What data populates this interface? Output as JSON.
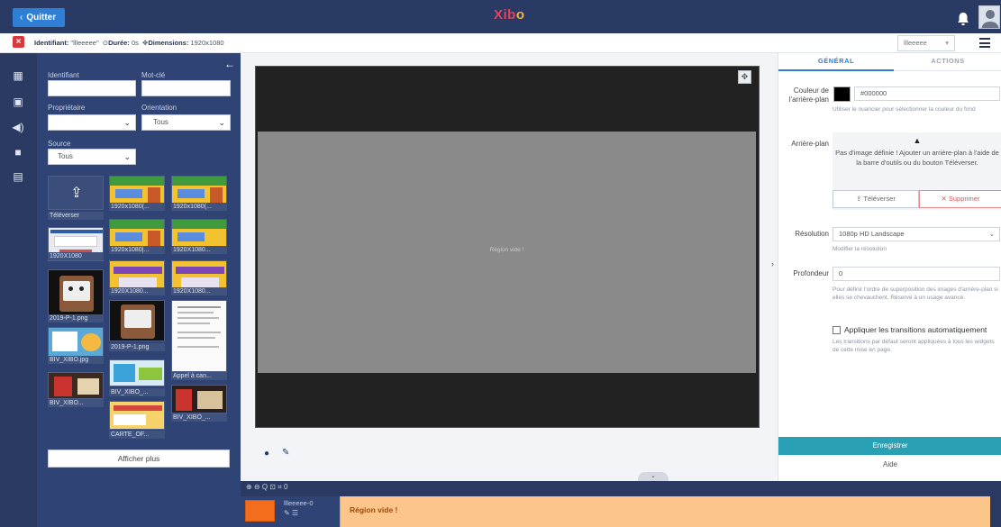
{
  "topbar": {
    "quit_label": "Quitter",
    "logo_a": "Xib",
    "logo_b": "o"
  },
  "infobar": {
    "id_label": "Identifiant:",
    "id_value": "\"llleeeee\"",
    "duration_label": "Durée:",
    "duration_value": "0s",
    "dimensions_label": "Dimensions:",
    "dimensions_value": "1920x1080",
    "layout_selected": "llleeeee"
  },
  "toolbox": {
    "identifier_label": "Identifiant",
    "keyword_label": "Mot-clé",
    "owner_label": "Propriétaire",
    "orientation_label": "Orientation",
    "orientation_value": "Tous",
    "source_label": "Source",
    "source_value": "Tous",
    "upload_label": "Téléverser",
    "show_more": "Afficher plus",
    "col1_labels": [
      "1920X1080",
      "2019-P-1.png",
      "BIV_XIBO.jpg",
      "BIV_XIBO..."
    ],
    "col2_labels": [
      "1920x1080(...",
      "1920x1080|...",
      "1920X1080...",
      "2019-P-1.png",
      "BIV_XIBO_...",
      "CARTE_OF..."
    ],
    "col3_labels": [
      "1920x1080(...",
      "1920X1080...",
      "1920X1080...",
      "Appel à can...",
      "BIV_XIBO_..."
    ]
  },
  "viewer": {
    "region_text": "Région vide !"
  },
  "timeline": {
    "tools": "⊕  ⊖  Q  ⊡        ⌗ 0",
    "region_name": "llleeeee-0",
    "track_text": "Région vide !"
  },
  "props": {
    "tab_general": "GÉNÉRAL",
    "tab_actions": "ACTIONS",
    "bgcolor_label": "Couleur de l'arrière-plan",
    "bgcolor_value": "#000000",
    "bgcolor_help": "Utiliser le nuancier pour sélectionner la couleur du fond",
    "bgimage_label": "Arrière-plan",
    "bgimage_warn": "Pas d'image définie ! Ajouter un arrière-plan à l'aide de la barre d'outils ou du bouton Téléverser.",
    "upload_btn": "Téléverser",
    "delete_btn": "Supprimer",
    "resolution_label": "Résolution",
    "resolution_value": "1080p HD Landscape",
    "resolution_help": "Modifier la résolution",
    "depth_label": "Profondeur",
    "depth_value": "0",
    "depth_help": "Pour définir l'ordre de superposition des images d'arrière-plan si elles se chevauchent. Réservé à un usage avancé.",
    "autotrans_label": "Appliquer les transitions automatiquement",
    "autotrans_help": "Les transitions par défaut seront appliquées à tous les widgets de cette mise en page.",
    "save_btn": "Enregistrer",
    "help_btn": "Aide"
  },
  "colors": {
    "accent": "#2f7fd6",
    "nav": "#2a3a63",
    "save": "#2aa0b4",
    "region_swatch": "#f46d1c",
    "track": "#fcc58a"
  }
}
